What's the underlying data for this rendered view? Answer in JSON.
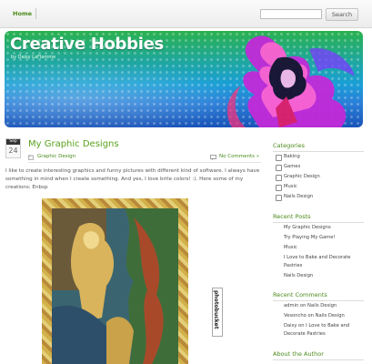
{
  "nav": {
    "home": "Home"
  },
  "search": {
    "placeholder": "",
    "button": "Search"
  },
  "banner": {
    "title": "Creative Hobbies",
    "subtitle": "by Daisy LaFlamme"
  },
  "post": {
    "month": "Sep",
    "day": "24",
    "title": "My Graphic Designs",
    "category": "Graphic Design",
    "comments": "No Comments »",
    "body": "I like to create interesting graphics and funny pictures with different kind of software. I always have something in mind when I create something.  And yes, I love brite colors! :).  Here some of my creations: Enbsp",
    "badge": "photobucket"
  },
  "sidebar": {
    "categories_title": "Categories",
    "categories": [
      "Baking",
      "Games",
      "Graphic Design",
      "Music",
      "Nails Design"
    ],
    "recent_posts_title": "Recent Posts",
    "recent_posts": [
      "My Graphic Designs",
      "Try Playing My Game!",
      "Music",
      "I Love to Bake and Decorate",
      "Pastries",
      "Nails Design"
    ],
    "recent_comments_title": "Recent Comments",
    "recent_comments": [
      "admin on Nails Design",
      "Vesoncho on Nails Design",
      "Daisy on I Love to Bake and",
      "Decorate Pastries"
    ],
    "about_title": "About the Author"
  },
  "colors": {
    "accent": "#5aa21c",
    "banner_top": "#2ab14f",
    "banner_bottom": "#1a54b8"
  }
}
